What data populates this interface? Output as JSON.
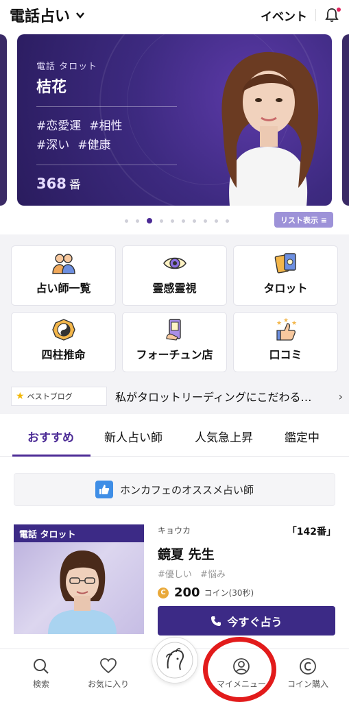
{
  "header": {
    "app_title": "電話占い",
    "event_link": "イベント"
  },
  "carousel": {
    "category": "電話 タロット",
    "name": "桔花",
    "tags": [
      "#恋愛運",
      "#相性",
      "#深い",
      "#健康"
    ],
    "number": "368",
    "number_suffix": "番",
    "total_dots": 10,
    "active_dot": 2,
    "list_button": "リスト表示 ≡"
  },
  "categories": [
    {
      "label": "占い師一覧",
      "icon": "people-icon"
    },
    {
      "label": "霊感霊視",
      "icon": "eye-icon"
    },
    {
      "label": "タロット",
      "icon": "tarot-card-icon"
    },
    {
      "label": "四柱推命",
      "icon": "yin-yang-icon"
    },
    {
      "label": "フォーチュン店",
      "icon": "phone-card-icon"
    },
    {
      "label": "口コミ",
      "icon": "thumbs-up-stars-icon"
    }
  ],
  "blog": {
    "badge": "ベストブログ",
    "title": "私がタロットリーディングにこだわる…"
  },
  "tabs": [
    "おすすめ",
    "新人占い師",
    "人気急上昇",
    "鑑定中"
  ],
  "active_tab": 0,
  "reco_banner": "ホンカフェのオススメ占い師",
  "card": {
    "category": "電話 タロット",
    "reading": "キョウカ",
    "rank": "「142番」",
    "name": "鏡夏 先生",
    "tags": [
      "#優しい",
      "#悩み"
    ],
    "coin_symbol": "C",
    "price": "200",
    "price_unit": "コイン(30秒)",
    "call_button": "今すぐ占う"
  },
  "bottom_nav": [
    {
      "label": "検索",
      "icon": "search-icon"
    },
    {
      "label": "お気に入り",
      "icon": "heart-icon"
    },
    {
      "label": "マイメニュー",
      "icon": "user-icon"
    },
    {
      "label": "コイン購入",
      "icon": "coin-icon"
    }
  ],
  "colors": {
    "brand": "#3c2a86",
    "accent": "#4b2a95",
    "highlight": "#e21b1b"
  }
}
